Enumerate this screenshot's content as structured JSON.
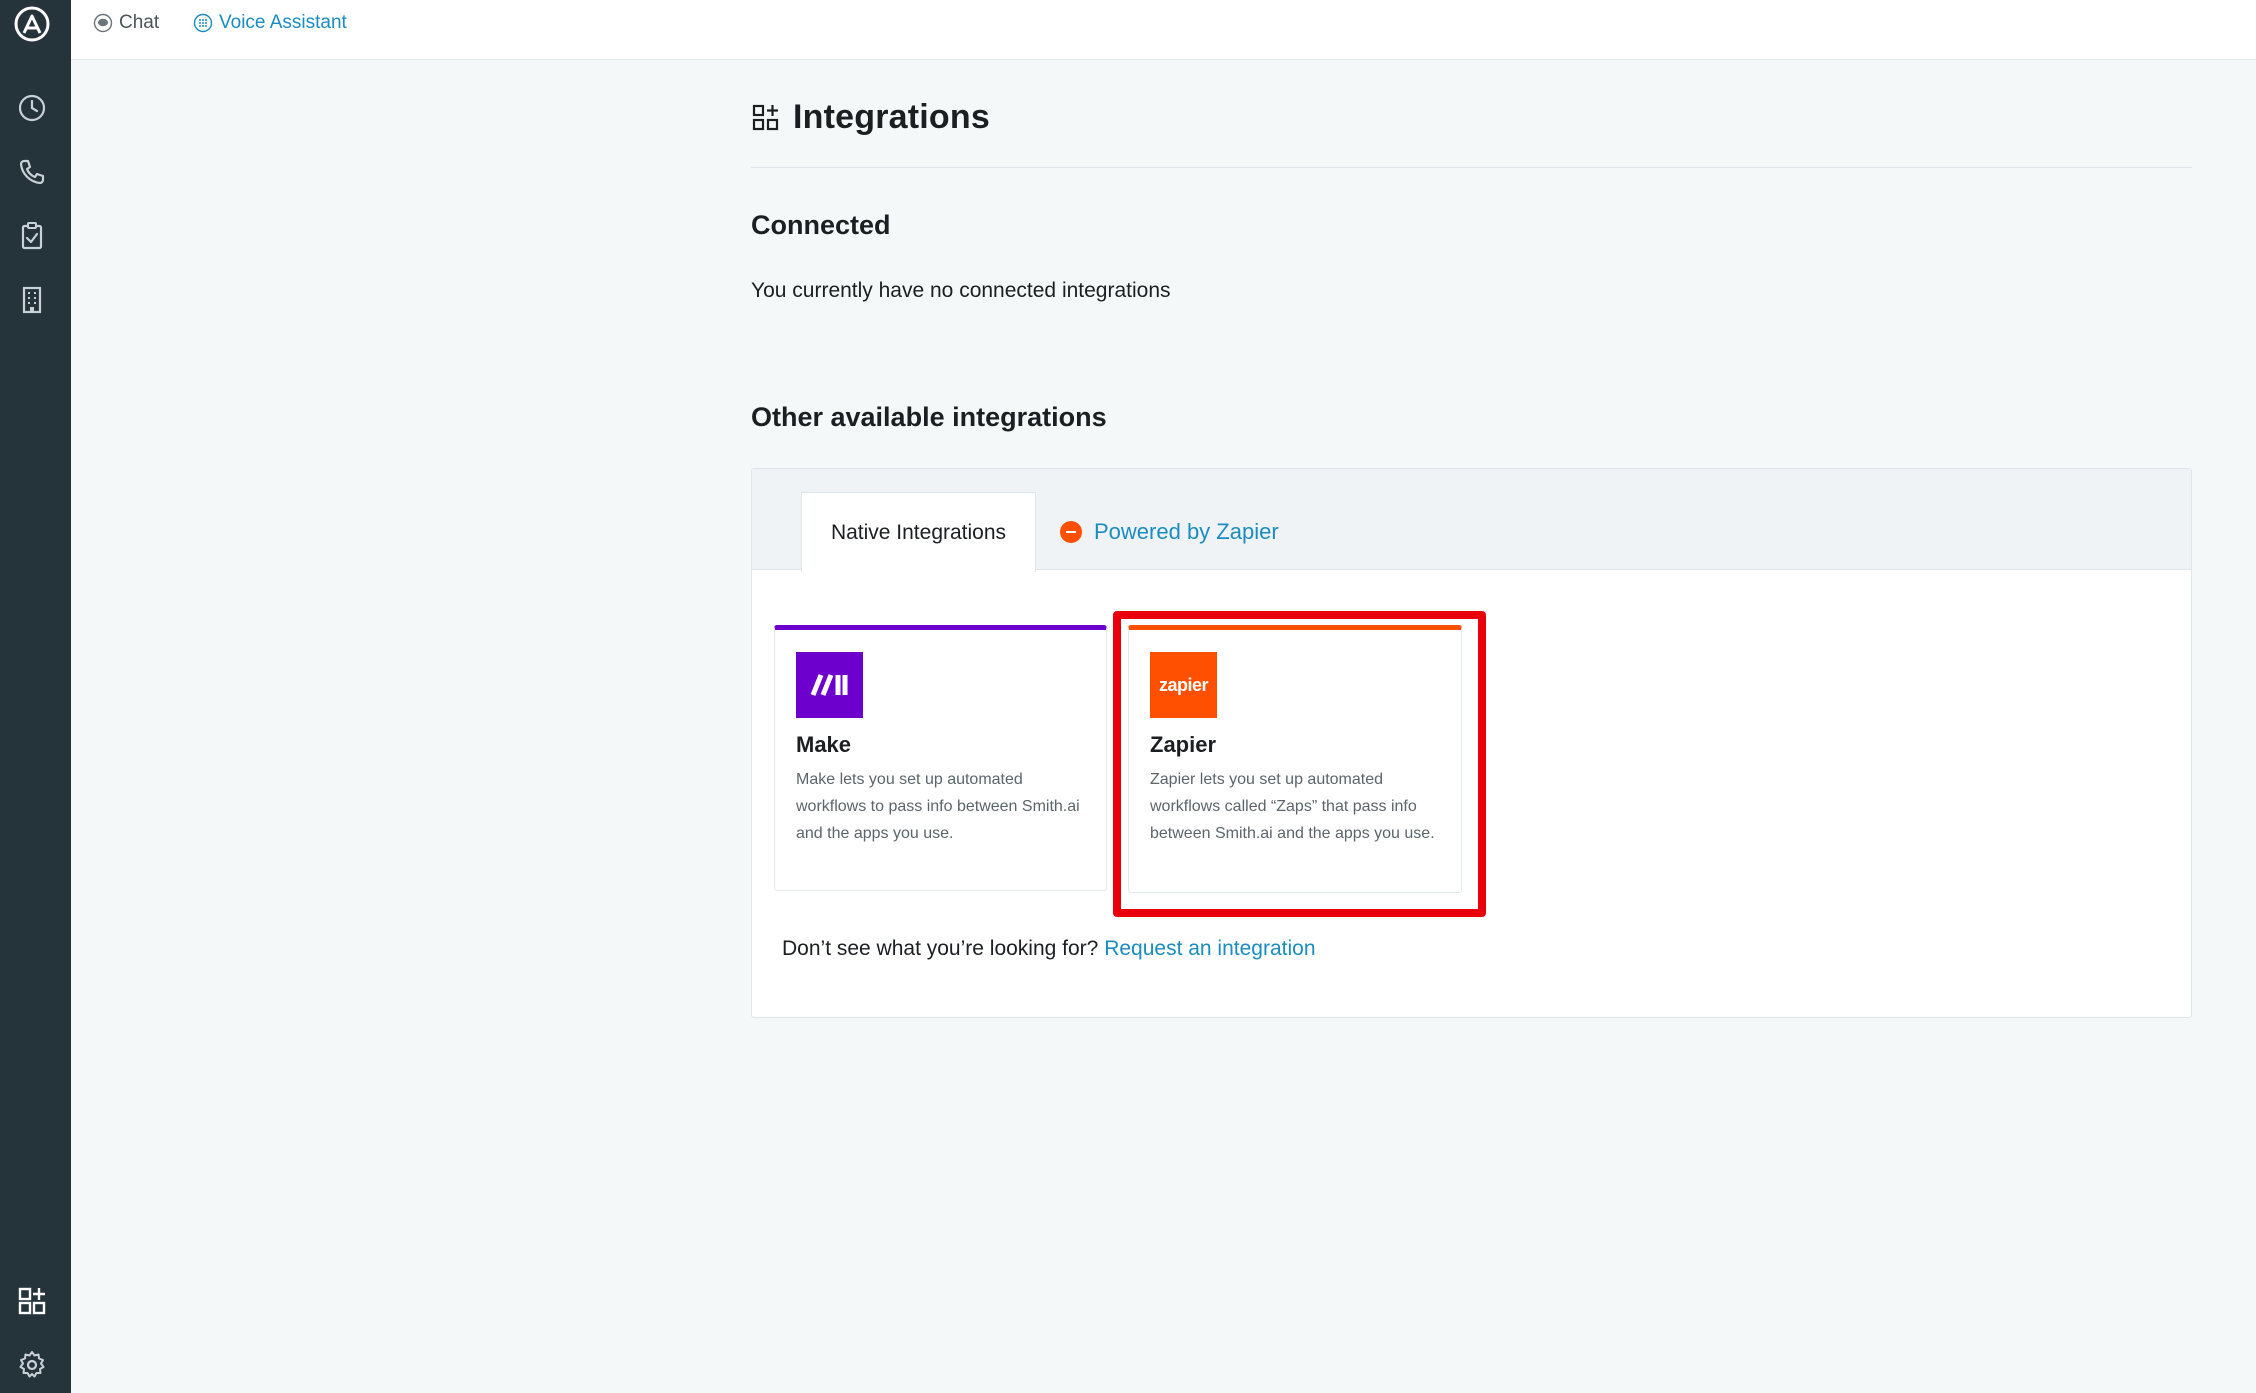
{
  "sidebar": {
    "icons": [
      "logo-icon",
      "clock-icon",
      "phone-icon",
      "clipboard-check-icon",
      "building-icon",
      "integrations-icon",
      "settings-icon"
    ]
  },
  "topbar": {
    "chat_label": "Chat",
    "voice_label": "Voice Assistant"
  },
  "page": {
    "title": "Integrations",
    "connected_heading": "Connected",
    "connected_empty": "You currently have no connected integrations",
    "other_heading": "Other available integrations"
  },
  "tabs": {
    "native": "Native Integrations",
    "zapier": "Powered by Zapier"
  },
  "cards": [
    {
      "name": "Make",
      "description": "Make lets you set up automated workflows to pass info between Smith.ai and the apps you use.",
      "color": "#6d00cc"
    },
    {
      "name": "Zapier",
      "logo_text": "zapier",
      "description": "Zapier lets you set up automated workflows called “Zaps” that pass info between Smith.ai and the apps you use.",
      "color": "#ff4f00"
    }
  ],
  "footer": {
    "prompt": "Don’t see what you’re looking for?",
    "link": "Request an integration"
  },
  "colors": {
    "sidebar": "#25333b",
    "accent": "#1b8cc0",
    "highlight": "#e8000b"
  }
}
